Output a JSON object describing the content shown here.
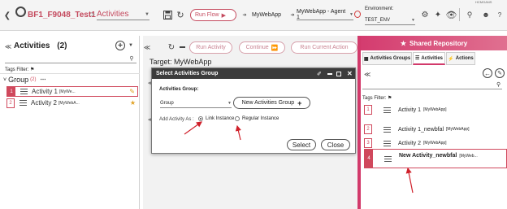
{
  "topbar": {
    "business_flow": "BF1_F9048_Test1",
    "breadcrumb": "Activities",
    "run_flow_label": "Run Flow",
    "app_label": "MyWebApp",
    "agent_select": "MyWebApp - Agent 1",
    "environment_label": "Environment:",
    "environment_value": "TEST_ENV",
    "top_right_label": "HCMGANS"
  },
  "left": {
    "title": "Activities",
    "count": "(2)",
    "tags_filter": "Tags Filter:",
    "group_label": "Group",
    "group_count": "(2)",
    "activities": [
      {
        "num": "1",
        "name": "Activity 1",
        "app": "[MyWe..."
      },
      {
        "num": "2",
        "name": "Activity 2",
        "app": "[MyWebA..."
      }
    ]
  },
  "middle": {
    "run_activity": "Run Activity",
    "continue": "Continue",
    "run_current_action": "Run Current Action",
    "target": "Target: MyWebApp"
  },
  "dialog": {
    "title": "Select Activities Group",
    "group_label": "Activities Group:",
    "group_value": "Group",
    "new_group_btn": "New Activities Group",
    "add_as_label": "Add Activity As :",
    "link_instance": "Link Instance",
    "regular_instance": "Regular Instance",
    "select_btn": "Select",
    "close_btn": "Close"
  },
  "right": {
    "title": "Shared Repository",
    "tabs": [
      "Activities Groups",
      "Activities",
      "Actions"
    ],
    "tags_filter": "Tags Filter:",
    "items": [
      {
        "num": "1",
        "name": "Activity 1",
        "app": "[MyWebApp]"
      },
      {
        "num": "2",
        "name": "Activity 1_newbfal",
        "app": "[MyWebApp]"
      },
      {
        "num": "3",
        "name": "Activity 2",
        "app": "[MyWebApp]"
      },
      {
        "num": "4",
        "name": "New Activity_newbfal",
        "app": "[MyWeb..."
      }
    ]
  },
  "colors": {
    "accent": "#d0485c",
    "repo_header": "#d43c6f",
    "arrow": "#d0202a"
  }
}
